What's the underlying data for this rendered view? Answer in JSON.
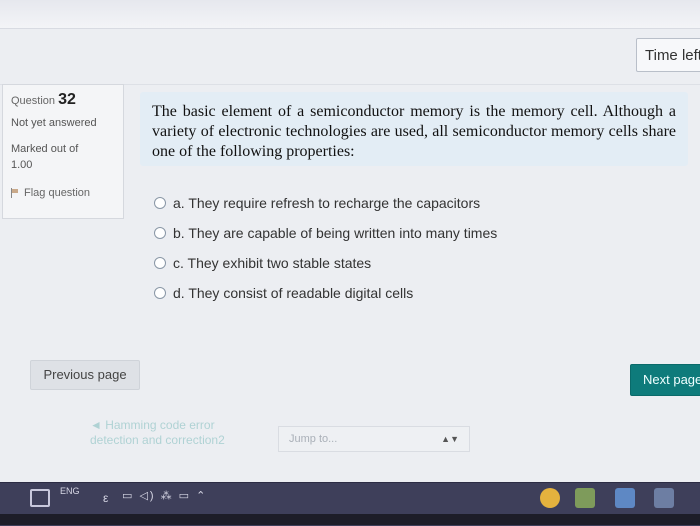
{
  "header": {
    "timer_label": "Time left"
  },
  "info": {
    "question_prefix": "Question",
    "question_number": "32",
    "state": "Not yet answered",
    "grade_label": "Marked out of",
    "grade_value": "1.00",
    "flag_label": "Flag question"
  },
  "question": {
    "text": "The basic element of a semiconductor memory is the memory cell. Although a variety of electronic technologies are used, all semiconductor memory cells share one of the following properties:"
  },
  "answers": [
    {
      "label": "a. They require refresh to recharge the capacitors"
    },
    {
      "label": "b. They are capable of being written into many times"
    },
    {
      "label": "c. They exhibit two stable states"
    },
    {
      "label": "d. They consist of readable digital cells"
    }
  ],
  "nav": {
    "previous_page": "Previous page",
    "next_page": "Next page",
    "previous_activity": "◄ Hamming code error detection and correction2",
    "jump_placeholder": "Jump to..."
  },
  "taskbar": {
    "lang": "ENG",
    "tray": "▭ ◁) ⁂ ▭ ⌃"
  },
  "icons": {
    "flag": "flag-icon",
    "radio": "radio-icon",
    "start": "windows-start-icon",
    "dropdown": "chevron-updown-icon"
  }
}
